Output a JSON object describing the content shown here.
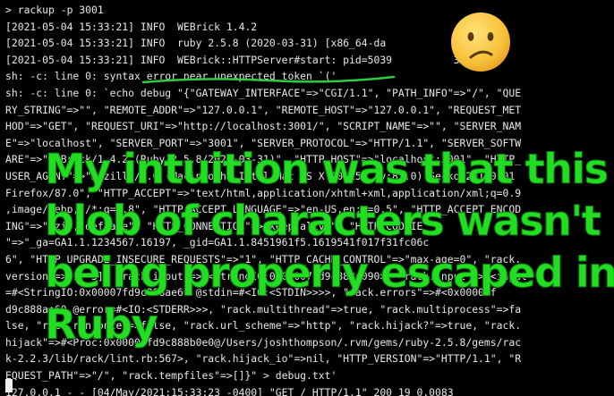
{
  "terminal": {
    "lines": [
      "> rackup -p 3001",
      "[2021-05-04 15:33:21] INFO  WEBrick 1.4.2",
      "[2021-05-04 15:33:21] INFO  ruby 2.5.8 (2020-03-31) [x86_64-da",
      "[2021-05-04 15:33:21] INFO  WEBrick::HTTPServer#start: pid=5039          3001",
      "sh: -c: line 0: syntax error near unexpected token `('",
      "sh: -c: line 0: `echo debug \"{\"GATEWAY_INTERFACE\"=>\"CGI/1.1\", \"PATH_INFO\"=>\"/\", \"QUE",
      "RY_STRING\"=>\"\", \"REMOTE_ADDR\"=>\"127.0.0.1\", \"REMOTE_HOST\"=>\"127.0.0.1\", \"REQUEST_MET",
      "HOD\"=>\"GET\", \"REQUEST_URI\"=>\"http://localhost:3001/\", \"SCRIPT_NAME\"=>\"\", \"SERVER_NAM",
      "E\"=>\"localhost\", \"SERVER_PORT\"=>\"3001\", \"SERVER_PROTOCOL\"=>\"HTTP/1.1\", \"SERVER_SOFTW",
      "ARE\"=>\"WEBrick/1.4.2 (Ruby/2.5.8/2020-03-31)\", \"HTTP_HOST\"=>\"localhost:3001\", \"HTTP_",
      "USER_AGENT\"=>\"Mozilla/5.0 (Macintosh; Intel Mac OS X 10.15; rv:87.0) Gecko/20100101",
      "Firefox/87.0\", \"HTTP_ACCEPT\"=>\"text/html,application/xhtml+xml,application/xml;q=0.9",
      ",image/webp,*/*;q=0.8\", \"HTTP_ACCEPT_LANGUAGE\"=>\"en-US,en;q=0.5\", \"HTTP_ACCEPT_ENCOD",
      "ING\"=>\"gzip, deflate\", \"HTTP_CONNECTION\"=>\"keep-alive\", \"HTTP_COOKIE",
      "\"=>\"_ga=GA1.1.1234567.16197, _gid=GA1.1.8451961f5.1619541f017f31fc06c",
      "6\", \"HTTP_UPGRADE_INSECURE_REQUESTS\"=>\"1\", \"HTTP_CACHE_CONTROL\"=>\"max-age=0\", \"rack.",
      "version\"=>[1, 3], \"rack.input\"=>#<StringIO:0x00007fd9c888a090>, \"rack.input\"=>#<input",
      "=#<StringIO:0x00007fd9c888ae60 @stdin=#<IO:<STDIN>>>>, \"rack.errors\"=>#<0x00007f",
      "d9c888ae60 @error=#<IO:<STDERR>>>, \"rack.multithread\"=>true, \"rack.multiprocess\"=>fa",
      "lse, \"rack.run_once\"=>false, \"rack.url_scheme\"=>\"http\", \"rack.hijack?\"=>true, \"rack.",
      "hijack\"=>#<Proc:0x00007fd9c888b0e0@/Users/joshthompson/.rvm/gems/ruby-2.5.8/gems/rac",
      "k-2.2.3/lib/rack/lint.rb:567>, \"rack.hijack_io\"=>nil, \"HTTP_VERSION\"=>\"HTTP/1.1\", \"R",
      "EQUEST_PATH\"=>\"/\", \"rack.tempfiles\"=>[]}\" > debug.txt'",
      "127.0.0.1 - - [04/May/2021:15:33:23 -0400] \"GET / HTTP/1.1\" 200 19 0.0083"
    ]
  },
  "caption": {
    "lines": [
      "My intuition was that this",
      "blob of characters wasn't",
      "being properly escaped in",
      "Ruby"
    ]
  },
  "emoji": "confused-face-icon",
  "colors": {
    "terminal_bg": "#000000",
    "terminal_text": "#e8e8e8",
    "caption": "#22dd22",
    "underline": "#2ecc40",
    "emoji_face": "#f7c23a"
  }
}
